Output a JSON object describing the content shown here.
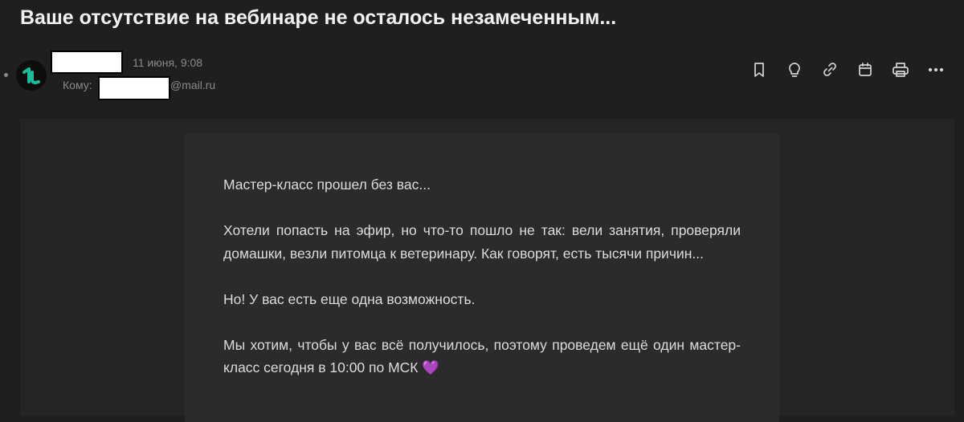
{
  "email": {
    "subject": "Ваше отсутствие на вебинаре не осталось незамеченным...",
    "date": "11 июня, 9:08",
    "to_label": "Кому:",
    "to_domain": "@mail.ru",
    "body": {
      "p1": "Мастер-класс прошел без вас...",
      "p2": "Хотели попасть на эфир, но что-то пошло не так: вели занятия, проверяли домашки, везли питомца к ветеринару. Как говорят,  есть тысячи причин...",
      "p3": "Но! У вас есть еще одна возможность.",
      "p4": "Мы хотим, чтобы у вас всё получилось, поэтому проведем ещё один мастер-класс сегодня в 10:00 по МСК",
      "p4_emoji": "💜"
    }
  },
  "toolbar": {
    "icons": [
      "bookmark-icon",
      "lightbulb-icon",
      "link-icon",
      "calendar-icon",
      "print-icon",
      "more-icon"
    ]
  },
  "colors": {
    "background": "#1f1f1f",
    "card": "#2b2b2b",
    "accent": "#1abc9c"
  }
}
